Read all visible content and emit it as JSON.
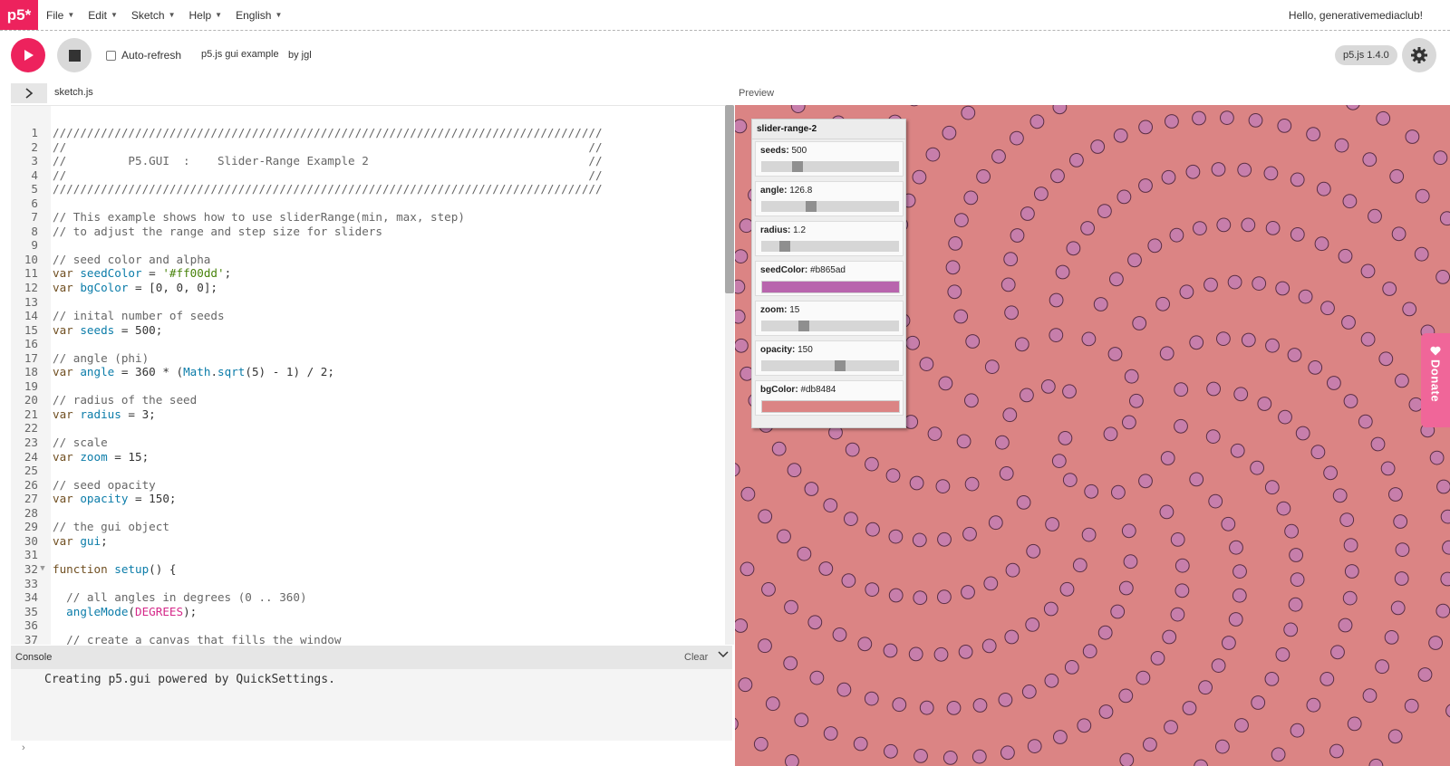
{
  "app": {
    "logo": "p5*",
    "menu": [
      "File",
      "Edit",
      "Sketch",
      "Help",
      "English"
    ],
    "greeting": "Hello, generativemediaclub!"
  },
  "toolbar": {
    "auto_refresh_label": "Auto-refresh",
    "sketch_name": "p5.js gui example",
    "author": "by jgl",
    "version": "p5.js 1.4.0"
  },
  "editor": {
    "file_name": "sketch.js",
    "preview_label": "Preview",
    "lines": [
      [
        [
          "c-comment",
          "////////////////////////////////////////////////////////////////////////////////"
        ]
      ],
      [
        [
          "c-comment",
          "//                                                                            //"
        ]
      ],
      [
        [
          "c-comment",
          "//         P5.GUI  :    Slider-Range Example 2                                //"
        ]
      ],
      [
        [
          "c-comment",
          "//                                                                            //"
        ]
      ],
      [
        [
          "c-comment",
          "////////////////////////////////////////////////////////////////////////////////"
        ]
      ],
      [],
      [
        [
          "c-comment",
          "// This example shows how to use sliderRange(min, max, step)"
        ]
      ],
      [
        [
          "c-comment",
          "// to adjust the range and step size for sliders"
        ]
      ],
      [],
      [
        [
          "c-comment",
          "// seed color and alpha"
        ]
      ],
      [
        [
          "c-kw",
          "var "
        ],
        [
          "c-var",
          "seedColor"
        ],
        [
          "",
          " = "
        ],
        [
          "c-str",
          "'#ff00dd'"
        ],
        [
          "",
          ";"
        ]
      ],
      [
        [
          "c-kw",
          "var "
        ],
        [
          "c-var",
          "bgColor"
        ],
        [
          "",
          " = [0, 0, 0];"
        ]
      ],
      [],
      [
        [
          "c-comment",
          "// inital number of seeds"
        ]
      ],
      [
        [
          "c-kw",
          "var "
        ],
        [
          "c-var",
          "seeds"
        ],
        [
          "",
          " = 500;"
        ]
      ],
      [],
      [
        [
          "c-comment",
          "// angle (phi)"
        ]
      ],
      [
        [
          "c-kw",
          "var "
        ],
        [
          "c-var",
          "angle"
        ],
        [
          "",
          " = 360 * ("
        ],
        [
          "c-var",
          "Math"
        ],
        [
          "",
          "."
        ],
        [
          "c-var",
          "sqrt"
        ],
        [
          "",
          "(5) - 1) / 2;"
        ]
      ],
      [],
      [
        [
          "c-comment",
          "// radius of the seed"
        ]
      ],
      [
        [
          "c-kw",
          "var "
        ],
        [
          "c-var",
          "radius"
        ],
        [
          "",
          " = 3;"
        ]
      ],
      [],
      [
        [
          "c-comment",
          "// scale"
        ]
      ],
      [
        [
          "c-kw",
          "var "
        ],
        [
          "c-var",
          "zoom"
        ],
        [
          "",
          " = 15;"
        ]
      ],
      [],
      [
        [
          "c-comment",
          "// seed opacity"
        ]
      ],
      [
        [
          "c-kw",
          "var "
        ],
        [
          "c-var",
          "opacity"
        ],
        [
          "",
          " = 150;"
        ]
      ],
      [],
      [
        [
          "c-comment",
          "// the gui object"
        ]
      ],
      [
        [
          "c-kw",
          "var "
        ],
        [
          "c-var",
          "gui"
        ],
        [
          "",
          ";"
        ]
      ],
      [],
      [
        [
          "c-kw",
          "function "
        ],
        [
          "c-var",
          "setup"
        ],
        [
          "",
          "() {"
        ]
      ],
      [],
      [
        [
          "",
          "  "
        ],
        [
          "c-comment",
          "// all angles in degrees (0 .. 360)"
        ]
      ],
      [
        [
          "",
          "  "
        ],
        [
          "c-var",
          "angleMode"
        ],
        [
          "",
          "("
        ],
        [
          "c-const",
          "DEGREES"
        ],
        [
          "",
          ");"
        ]
      ],
      [],
      [
        [
          "",
          "  "
        ],
        [
          "c-comment",
          "// create a canvas that fills the window"
        ]
      ]
    ]
  },
  "console": {
    "title": "Console",
    "clear_label": "Clear",
    "message": "Creating p5.gui powered by QuickSettings.",
    "prompt": "›"
  },
  "gui": {
    "title": "slider-range-2",
    "controls": [
      {
        "label": "seeds:",
        "value": "500",
        "type": "slider",
        "level": 0.24
      },
      {
        "label": "angle:",
        "value": "126.8",
        "type": "slider",
        "level": 0.35
      },
      {
        "label": "radius:",
        "value": "1.2",
        "type": "slider",
        "level": 0.14
      },
      {
        "label": "seedColor:",
        "value": "#b865ad",
        "type": "color",
        "color": "#b865ad"
      },
      {
        "label": "zoom:",
        "value": "15",
        "type": "slider",
        "level": 0.29
      },
      {
        "label": "opacity:",
        "value": "150",
        "type": "slider",
        "level": 0.58
      },
      {
        "label": "bgColor:",
        "value": "#db8484",
        "type": "color",
        "color": "#db8484"
      }
    ]
  },
  "canvas": {
    "background": "#db8484",
    "seed_fill": "#c77eab",
    "seed_stroke": "#5a2e43",
    "seeds": 500,
    "angle": 126.8,
    "zoom": 15
  },
  "donate_label": "Donate",
  "colors": {
    "accent": "#ed225d",
    "donate": "#f06699"
  }
}
